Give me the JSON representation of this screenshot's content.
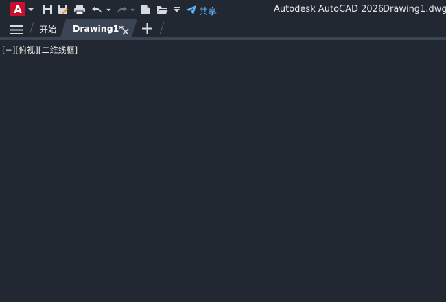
{
  "app": {
    "logo_letter": "A",
    "title": "Autodesk AutoCAD 2026",
    "document_name": "Drawing1.dwg",
    "share_label": "共享"
  },
  "tabs": {
    "start_label": "开始",
    "active_label": "Drawing1*"
  },
  "viewport": {
    "label": "[−][俯视][二维线框]"
  },
  "colors": {
    "background": "#222831",
    "logo": "#c8102e",
    "accent": "#5fb4ff"
  }
}
